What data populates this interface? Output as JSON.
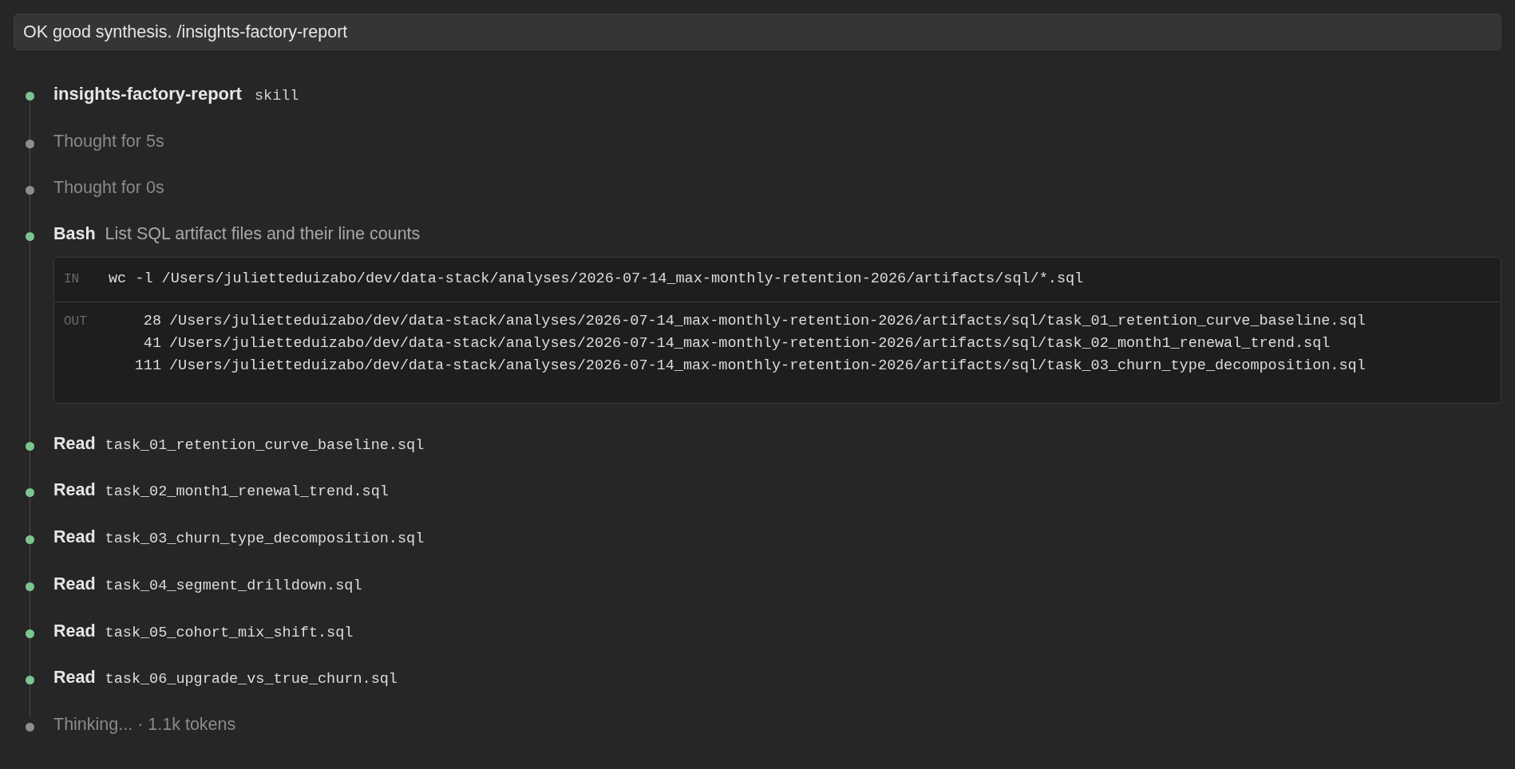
{
  "prompt": {
    "text": "OK good synthesis. /insights-factory-report"
  },
  "steps": [
    {
      "kind": "skill",
      "color": "#7cc58f",
      "title": "insights-factory-report",
      "tag": "skill"
    },
    {
      "kind": "thought",
      "color": "#8e8e8e",
      "text": "Thought for 5s"
    },
    {
      "kind": "thought",
      "color": "#8e8e8e",
      "text": "Thought for 0s"
    },
    {
      "kind": "bash",
      "color": "#7cc58f",
      "title": "Bash",
      "description": "List SQL artifact files and their line counts",
      "input_label": "IN",
      "command": "wc -l /Users/julietteduizabo/dev/data-stack/analyses/2026-07-14_max-monthly-retention-2026/artifacts/sql/*.sql",
      "output_label": "OUT",
      "output_lines": [
        {
          "count": "28",
          "path": "/Users/julietteduizabo/dev/data-stack/analyses/2026-07-14_max-monthly-retention-2026/artifacts/sql/task_01_retention_curve_baseline.sql"
        },
        {
          "count": "41",
          "path": "/Users/julietteduizabo/dev/data-stack/analyses/2026-07-14_max-monthly-retention-2026/artifacts/sql/task_02_month1_renewal_trend.sql"
        },
        {
          "count": "111",
          "path": "/Users/julietteduizabo/dev/data-stack/analyses/2026-07-14_max-monthly-retention-2026/artifacts/sql/task_03_churn_type_decomposition.sql"
        }
      ]
    },
    {
      "kind": "read",
      "color": "#7cc58f",
      "title": "Read",
      "file": "task_01_retention_curve_baseline.sql"
    },
    {
      "kind": "read",
      "color": "#7cc58f",
      "title": "Read",
      "file": "task_02_month1_renewal_trend.sql"
    },
    {
      "kind": "read",
      "color": "#7cc58f",
      "title": "Read",
      "file": "task_03_churn_type_decomposition.sql"
    },
    {
      "kind": "read",
      "color": "#7cc58f",
      "title": "Read",
      "file": "task_04_segment_drilldown.sql"
    },
    {
      "kind": "read",
      "color": "#7cc58f",
      "title": "Read",
      "file": "task_05_cohort_mix_shift.sql"
    },
    {
      "kind": "read",
      "color": "#7cc58f",
      "title": "Read",
      "file": "task_06_upgrade_vs_true_churn.sql"
    },
    {
      "kind": "thinking",
      "color": "#8e8e8e",
      "text": "Thinking... · 1.1k tokens"
    }
  ]
}
